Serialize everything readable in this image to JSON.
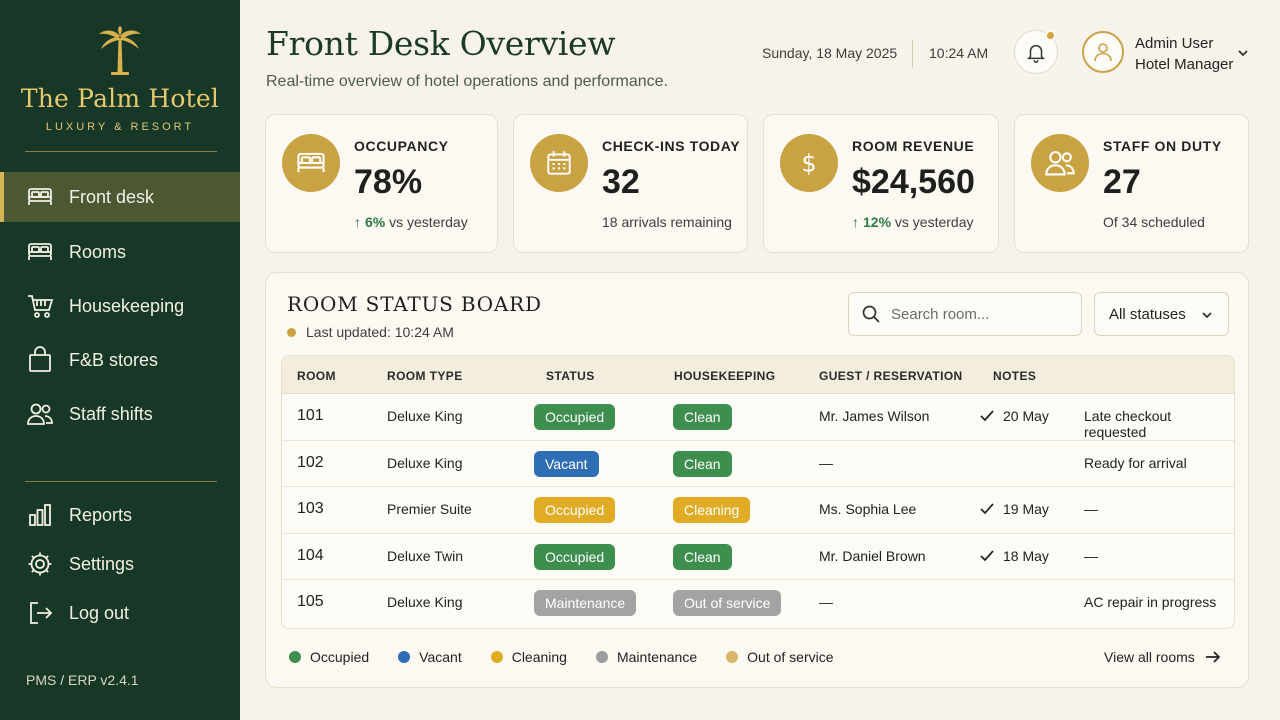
{
  "brand": {
    "name": "The Palm Hotel",
    "tagline": "LUXURY & RESORT",
    "logo_icon": "palm-tree-icon",
    "gold": "#c9a243",
    "green": "#173826"
  },
  "sidebar": {
    "items": [
      {
        "label": "Front desk",
        "icon": "bed-icon",
        "active": true
      },
      {
        "label": "Rooms",
        "icon": "bed-icon",
        "active": false
      },
      {
        "label": "Housekeeping",
        "icon": "cart-icon",
        "active": false
      },
      {
        "label": "F&B stores",
        "icon": "shopping-bag-icon",
        "active": false
      },
      {
        "label": "Staff shifts",
        "icon": "users-icon",
        "active": false
      }
    ],
    "bottom_items": [
      {
        "label": "Reports",
        "icon": "bar-chart-icon"
      },
      {
        "label": "Settings",
        "icon": "gear-icon"
      },
      {
        "label": "Log out",
        "icon": "logout-icon"
      }
    ],
    "version": "PMS / ERP v2.4.1"
  },
  "header": {
    "title": "Front Desk Overview",
    "subtitle": "Real-time overview of hotel operations and performance.",
    "date": "Sunday, 18 May 2025",
    "time": "10:24 AM",
    "user_name": "Admin User",
    "user_role": "Hotel Manager"
  },
  "stats": [
    {
      "label": "OCCUPANCY",
      "value": "78%",
      "trend": "6%",
      "note": "vs yesterday",
      "icon": "bed-icon"
    },
    {
      "label": "CHECK-INS TODAY",
      "value": "32",
      "note": "18 arrivals remaining",
      "icon": "calendar-icon"
    },
    {
      "label": "ROOM REVENUE",
      "value": "$24,560",
      "trend": "12%",
      "note": "vs yesterday",
      "icon": "dollar-icon"
    },
    {
      "label": "STAFF ON DUTY",
      "value": "27",
      "note": "Of 34 scheduled",
      "icon": "users-icon"
    }
  ],
  "board": {
    "title": "ROOM STATUS BOARD",
    "updated": "Last updated: 10:24 AM",
    "search_placeholder": "Search room...",
    "filter_value": "All statuses",
    "columns": [
      "ROOM",
      "ROOM TYPE",
      "STATUS",
      "HOUSEKEEPING",
      "GUEST / RESERVATION",
      "NOTES"
    ],
    "rows": [
      {
        "room": "101",
        "type": "Deluxe King",
        "status": "Occupied",
        "status_color": "#3e8f4f",
        "hk": "Clean",
        "hk_color": "#3e8f4f",
        "guest": "Mr. James Wilson",
        "checkout": "20 May",
        "notes": "Late checkout requested"
      },
      {
        "room": "102",
        "type": "Deluxe King",
        "status": "Vacant",
        "status_color": "#2f6db5",
        "hk": "Clean",
        "hk_color": "#3e8f4f",
        "guest": "—",
        "checkout": "",
        "notes": "Ready for arrival"
      },
      {
        "room": "103",
        "type": "Premier Suite",
        "status": "Occupied",
        "status_color": "#e0ac25",
        "hk": "Cleaning",
        "hk_color": "#e0ac25",
        "guest": "Ms. Sophia Lee",
        "checkout": "19 May",
        "notes": "—"
      },
      {
        "room": "104",
        "type": "Deluxe Twin",
        "status": "Occupied",
        "status_color": "#3e8f4f",
        "hk": "Clean",
        "hk_color": "#3e8f4f",
        "guest": "Mr. Daniel Brown",
        "checkout": "18 May",
        "notes": "—"
      },
      {
        "room": "105",
        "type": "Deluxe King",
        "status": "Maintenance",
        "status_color": "#a3a3a3",
        "hk": "Out of service",
        "hk_color": "#a3a3a3",
        "guest": "—",
        "checkout": "",
        "notes": "AC repair in progress"
      }
    ],
    "legend": [
      {
        "label": "Occupied",
        "color": "#3e8f4f"
      },
      {
        "label": "Vacant",
        "color": "#2f6db5"
      },
      {
        "label": "Cleaning",
        "color": "#e0ac25"
      },
      {
        "label": "Maintenance",
        "color": "#9c9c9c"
      },
      {
        "label": "Out of service",
        "color": "#d9b56a"
      }
    ],
    "view_all": "View all rooms"
  }
}
